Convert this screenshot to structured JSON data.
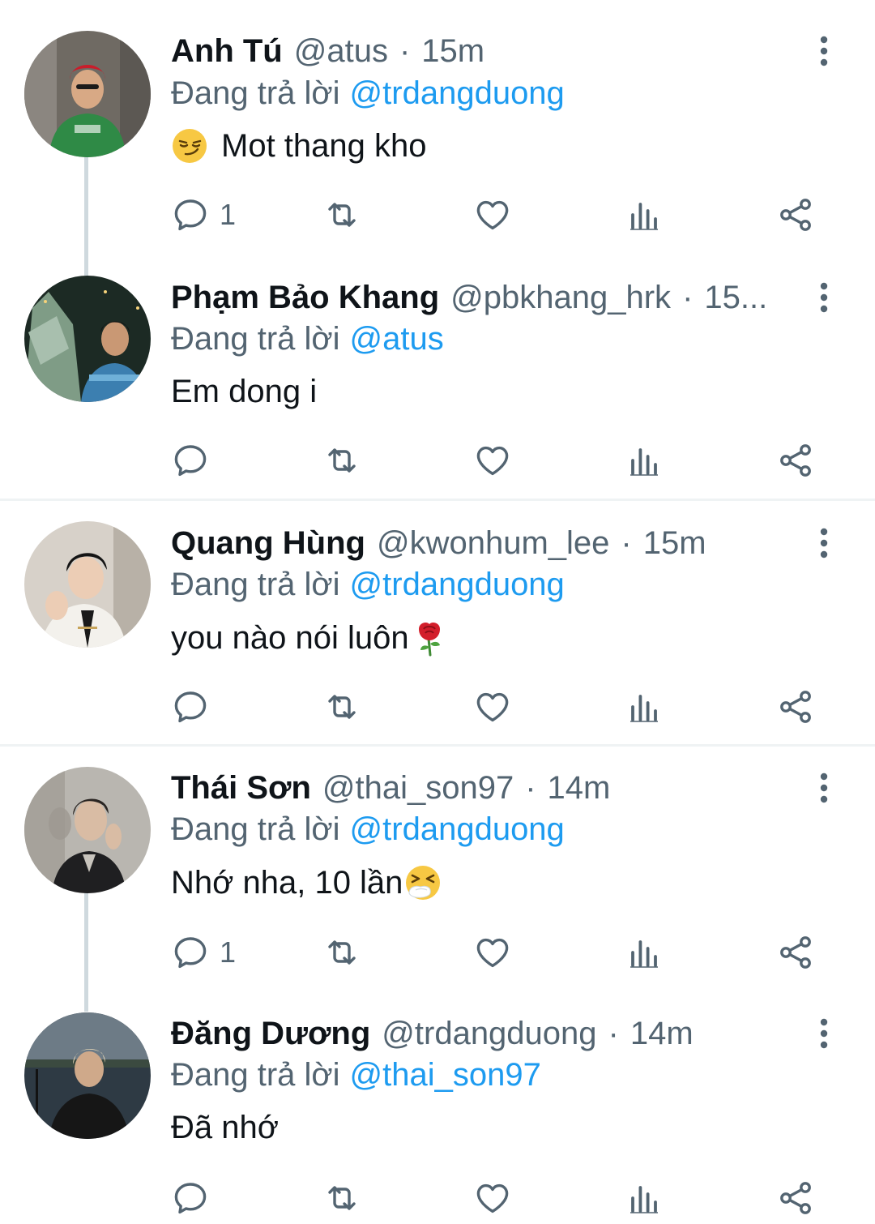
{
  "colors": {
    "text_primary": "#0f1419",
    "text_secondary": "#536471",
    "link": "#1d9bf0",
    "thread_line": "#cfd9de",
    "divider": "#eff3f4"
  },
  "reply_prefix": "Đang trả lời",
  "tweets": [
    {
      "name": "Anh Tú",
      "handle": "@atus",
      "separator": "·",
      "time": "15m",
      "reply_to": "@trdangduong",
      "text": "Mot thang kho",
      "emoji_before": "smirking-face",
      "reply_count": "1",
      "more_icon": "more-vertical-icon"
    },
    {
      "name": "Phạm Bảo Khang",
      "handle": "@pbkhang_hrk",
      "separator": "·",
      "time": "15...",
      "reply_to": "@atus",
      "text": "Em dong i",
      "reply_count": "",
      "more_icon": "more-vertical-icon"
    },
    {
      "name": "Quang Hùng",
      "handle": "@kwonhum_lee",
      "separator": "·",
      "time": "15m",
      "reply_to": "@trdangduong",
      "text": "you nào nói luôn",
      "emoji_after": "rose",
      "reply_count": "",
      "more_icon": "more-vertical-icon"
    },
    {
      "name": "Thái Sơn",
      "handle": "@thai_son97",
      "separator": "·",
      "time": "14m",
      "reply_to": "@trdangduong",
      "text": "Nhớ nha, 10 lần",
      "emoji_after": "sneezing-face",
      "reply_count": "1",
      "more_icon": "more-vertical-icon"
    },
    {
      "name": "Đăng Dương",
      "handle": "@trdangduong",
      "separator": "·",
      "time": "14m",
      "reply_to": "@thai_son97",
      "text": "Đã nhớ",
      "reply_count": "",
      "more_icon": "more-vertical-icon"
    }
  ],
  "action_icons": [
    "reply-icon",
    "retweet-icon",
    "like-icon",
    "views-icon",
    "share-icon"
  ]
}
